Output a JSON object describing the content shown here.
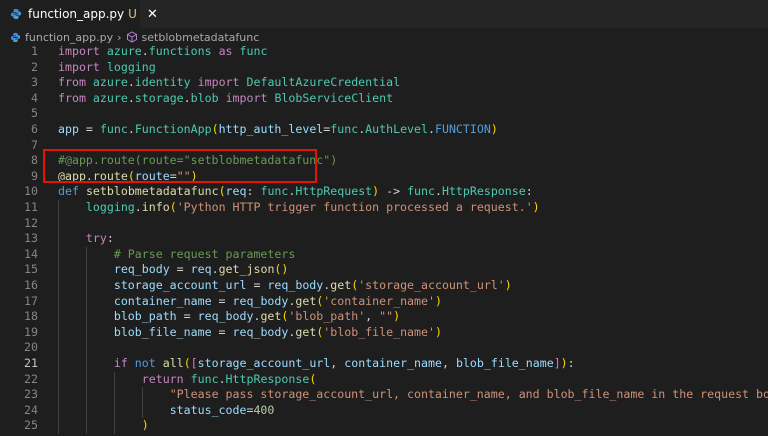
{
  "tab": {
    "filename": "function_app.py",
    "status": "U",
    "close_glyph": "✕"
  },
  "breadcrumb": {
    "file": "function_app.py",
    "separator": "›",
    "symbol": "setblobmetadatafunc"
  },
  "editor": {
    "active_line": 21,
    "highlighted_lines": [
      8,
      9
    ],
    "highlight_color": "#e51400",
    "lines": [
      {
        "num": "1",
        "tokens": [
          [
            "k",
            "import"
          ],
          [
            "w",
            " "
          ],
          [
            "c",
            "azure"
          ],
          [
            "w",
            "."
          ],
          [
            "c",
            "functions"
          ],
          [
            "w",
            " "
          ],
          [
            "k",
            "as"
          ],
          [
            "w",
            " "
          ],
          [
            "c",
            "func"
          ]
        ]
      },
      {
        "num": "2",
        "tokens": [
          [
            "k",
            "import"
          ],
          [
            "w",
            " "
          ],
          [
            "c",
            "logging"
          ]
        ]
      },
      {
        "num": "3",
        "tokens": [
          [
            "k",
            "from"
          ],
          [
            "w",
            " "
          ],
          [
            "c",
            "azure"
          ],
          [
            "w",
            "."
          ],
          [
            "c",
            "identity"
          ],
          [
            "w",
            " "
          ],
          [
            "k",
            "import"
          ],
          [
            "w",
            " "
          ],
          [
            "c",
            "DefaultAzureCredential"
          ]
        ]
      },
      {
        "num": "4",
        "tokens": [
          [
            "k",
            "from"
          ],
          [
            "w",
            " "
          ],
          [
            "c",
            "azure"
          ],
          [
            "w",
            "."
          ],
          [
            "c",
            "storage"
          ],
          [
            "w",
            "."
          ],
          [
            "c",
            "blob"
          ],
          [
            "w",
            " "
          ],
          [
            "k",
            "import"
          ],
          [
            "w",
            " "
          ],
          [
            "c",
            "BlobServiceClient"
          ]
        ]
      },
      {
        "num": "5",
        "tokens": []
      },
      {
        "num": "6",
        "tokens": [
          [
            "v",
            "app"
          ],
          [
            "w",
            " = "
          ],
          [
            "c",
            "func"
          ],
          [
            "w",
            "."
          ],
          [
            "c",
            "FunctionApp"
          ],
          [
            "p1",
            "("
          ],
          [
            "v",
            "http_auth_level"
          ],
          [
            "w",
            "="
          ],
          [
            "c",
            "func"
          ],
          [
            "w",
            "."
          ],
          [
            "c",
            "AuthLevel"
          ],
          [
            "w",
            "."
          ],
          [
            "b",
            "FUNCTION"
          ],
          [
            "p1",
            ")"
          ]
        ]
      },
      {
        "num": "7",
        "tokens": []
      },
      {
        "num": "8",
        "tokens": [
          [
            "cm",
            "#@app.route(route=\"setblobmetadatafunc\")"
          ]
        ]
      },
      {
        "num": "9",
        "tokens": [
          [
            "f",
            "@app"
          ],
          [
            "w",
            "."
          ],
          [
            "f",
            "route"
          ],
          [
            "p1",
            "("
          ],
          [
            "v",
            "route"
          ],
          [
            "w",
            "="
          ],
          [
            "s",
            "\"\""
          ],
          [
            "p1",
            ")"
          ]
        ]
      },
      {
        "num": "10",
        "tokens": [
          [
            "b",
            "def"
          ],
          [
            "w",
            " "
          ],
          [
            "f",
            "setblobmetadatafunc"
          ],
          [
            "p1",
            "("
          ],
          [
            "v",
            "req"
          ],
          [
            "w",
            ": "
          ],
          [
            "c",
            "func"
          ],
          [
            "w",
            "."
          ],
          [
            "c",
            "HttpRequest"
          ],
          [
            "p1",
            ")"
          ],
          [
            "w",
            " -> "
          ],
          [
            "c",
            "func"
          ],
          [
            "w",
            "."
          ],
          [
            "c",
            "HttpResponse"
          ],
          [
            "w",
            ":"
          ]
        ]
      },
      {
        "num": "11",
        "tokens": [
          [
            "w",
            "    "
          ],
          [
            "c",
            "logging"
          ],
          [
            "w",
            "."
          ],
          [
            "f",
            "info"
          ],
          [
            "p1",
            "("
          ],
          [
            "s",
            "'Python HTTP trigger function processed a request.'"
          ],
          [
            "p1",
            ")"
          ]
        ]
      },
      {
        "num": "12",
        "tokens": []
      },
      {
        "num": "13",
        "tokens": [
          [
            "w",
            "    "
          ],
          [
            "k",
            "try"
          ],
          [
            "w",
            ":"
          ]
        ]
      },
      {
        "num": "14",
        "tokens": [
          [
            "w",
            "        "
          ],
          [
            "cm",
            "# Parse request parameters"
          ]
        ]
      },
      {
        "num": "15",
        "tokens": [
          [
            "w",
            "        "
          ],
          [
            "v",
            "req_body"
          ],
          [
            "w",
            " = "
          ],
          [
            "v",
            "req"
          ],
          [
            "w",
            "."
          ],
          [
            "f",
            "get_json"
          ],
          [
            "p1",
            "()"
          ]
        ]
      },
      {
        "num": "16",
        "tokens": [
          [
            "w",
            "        "
          ],
          [
            "v",
            "storage_account_url"
          ],
          [
            "w",
            " = "
          ],
          [
            "v",
            "req_body"
          ],
          [
            "w",
            "."
          ],
          [
            "f",
            "get"
          ],
          [
            "p1",
            "("
          ],
          [
            "s",
            "'storage_account_url'"
          ],
          [
            "p1",
            ")"
          ]
        ]
      },
      {
        "num": "17",
        "tokens": [
          [
            "w",
            "        "
          ],
          [
            "v",
            "container_name"
          ],
          [
            "w",
            " = "
          ],
          [
            "v",
            "req_body"
          ],
          [
            "w",
            "."
          ],
          [
            "f",
            "get"
          ],
          [
            "p1",
            "("
          ],
          [
            "s",
            "'container_name'"
          ],
          [
            "p1",
            ")"
          ]
        ]
      },
      {
        "num": "18",
        "tokens": [
          [
            "w",
            "        "
          ],
          [
            "v",
            "blob_path"
          ],
          [
            "w",
            " = "
          ],
          [
            "v",
            "req_body"
          ],
          [
            "w",
            "."
          ],
          [
            "f",
            "get"
          ],
          [
            "p1",
            "("
          ],
          [
            "s",
            "'blob_path'"
          ],
          [
            "w",
            ", "
          ],
          [
            "s",
            "\"\""
          ],
          [
            "p1",
            ")"
          ]
        ]
      },
      {
        "num": "19",
        "tokens": [
          [
            "w",
            "        "
          ],
          [
            "v",
            "blob_file_name"
          ],
          [
            "w",
            " = "
          ],
          [
            "v",
            "req_body"
          ],
          [
            "w",
            "."
          ],
          [
            "f",
            "get"
          ],
          [
            "p1",
            "("
          ],
          [
            "s",
            "'blob_file_name'"
          ],
          [
            "p1",
            ")"
          ]
        ]
      },
      {
        "num": "20",
        "tokens": []
      },
      {
        "num": "21",
        "tokens": [
          [
            "w",
            "        "
          ],
          [
            "k",
            "if"
          ],
          [
            "w",
            " "
          ],
          [
            "b",
            "not"
          ],
          [
            "w",
            " "
          ],
          [
            "f",
            "all"
          ],
          [
            "p1",
            "("
          ],
          [
            "p2",
            "["
          ],
          [
            "v",
            "storage_account_url"
          ],
          [
            "w",
            ", "
          ],
          [
            "v",
            "container_name"
          ],
          [
            "w",
            ", "
          ],
          [
            "v",
            "blob_file_name"
          ],
          [
            "p2",
            "]"
          ],
          [
            "p1",
            ")"
          ],
          [
            "w",
            ":"
          ]
        ]
      },
      {
        "num": "22",
        "tokens": [
          [
            "w",
            "            "
          ],
          [
            "k",
            "return"
          ],
          [
            "w",
            " "
          ],
          [
            "c",
            "func"
          ],
          [
            "w",
            "."
          ],
          [
            "c",
            "HttpResponse"
          ],
          [
            "p1",
            "("
          ]
        ]
      },
      {
        "num": "23",
        "tokens": [
          [
            "w",
            "                "
          ],
          [
            "s",
            "\"Please pass storage_account_url, container_name, and blob_file_name in the request body\""
          ],
          [
            "w",
            ","
          ]
        ]
      },
      {
        "num": "24",
        "tokens": [
          [
            "w",
            "                "
          ],
          [
            "v",
            "status_code"
          ],
          [
            "w",
            "="
          ],
          [
            "n",
            "400"
          ]
        ]
      },
      {
        "num": "25",
        "tokens": [
          [
            "w",
            "            "
          ],
          [
            "p1",
            ")"
          ]
        ]
      }
    ]
  }
}
